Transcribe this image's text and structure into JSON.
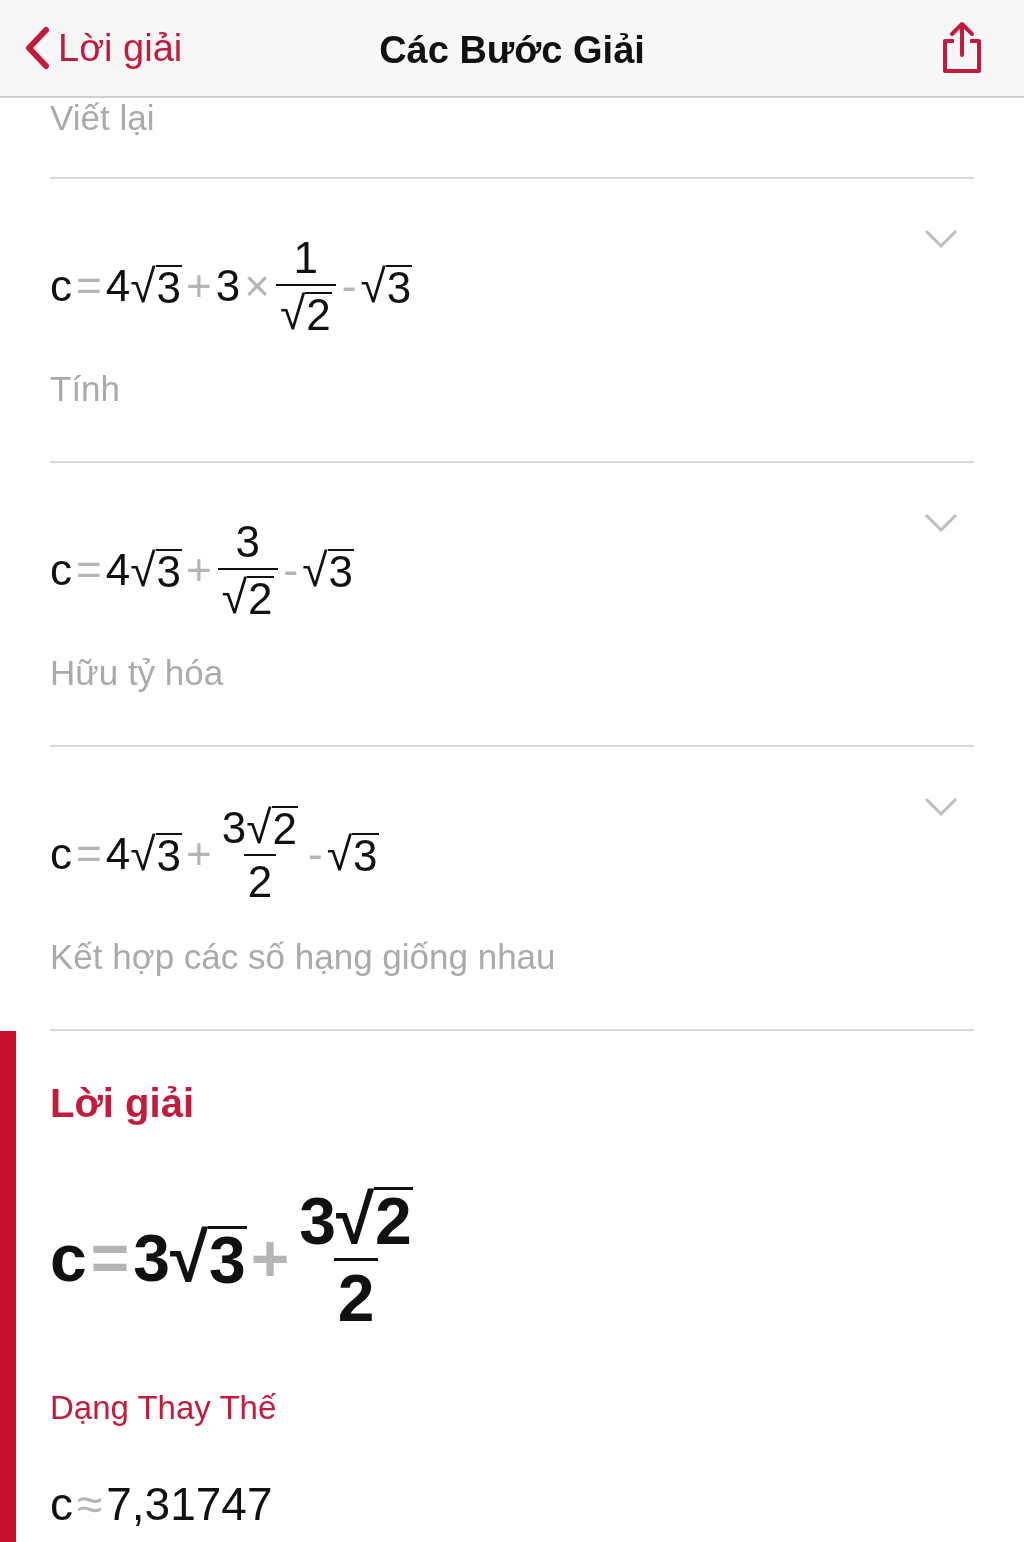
{
  "nav": {
    "back_label": "Lời giải",
    "title": "Các Bước Giải"
  },
  "previous_caption": "Viết lại",
  "steps": [
    {
      "expanded": false,
      "caption": "Tính",
      "formula": [
        {
          "kind": "sym",
          "text": "c"
        },
        {
          "kind": "op",
          "text": "="
        },
        {
          "kind": "sym",
          "text": "4"
        },
        {
          "kind": "sqrt",
          "sign": "√",
          "radicand": "3"
        },
        {
          "kind": "op",
          "text": "+"
        },
        {
          "kind": "sym",
          "text": "3"
        },
        {
          "kind": "op",
          "text": "×"
        },
        {
          "kind": "frac",
          "num": [
            {
              "kind": "sym",
              "text": "1"
            }
          ],
          "den": [
            {
              "kind": "sqrt",
              "sign": "√",
              "radicand": "2"
            }
          ]
        },
        {
          "kind": "op",
          "text": "-"
        },
        {
          "kind": "sqrt",
          "sign": "√",
          "radicand": "3"
        }
      ]
    },
    {
      "expanded": false,
      "caption": "Hữu tỷ hóa",
      "formula": [
        {
          "kind": "sym",
          "text": "c"
        },
        {
          "kind": "op",
          "text": "="
        },
        {
          "kind": "sym",
          "text": "4"
        },
        {
          "kind": "sqrt",
          "sign": "√",
          "radicand": "3"
        },
        {
          "kind": "op",
          "text": "+"
        },
        {
          "kind": "frac",
          "num": [
            {
              "kind": "sym",
              "text": "3"
            }
          ],
          "den": [
            {
              "kind": "sqrt",
              "sign": "√",
              "radicand": "2"
            }
          ]
        },
        {
          "kind": "op",
          "text": "-"
        },
        {
          "kind": "sqrt",
          "sign": "√",
          "radicand": "3"
        }
      ]
    },
    {
      "expanded": false,
      "caption": "Kết hợp các số hạng giống nhau",
      "formula": [
        {
          "kind": "sym",
          "text": "c"
        },
        {
          "kind": "op",
          "text": "="
        },
        {
          "kind": "sym",
          "text": "4"
        },
        {
          "kind": "sqrt",
          "sign": "√",
          "radicand": "3"
        },
        {
          "kind": "op",
          "text": "+"
        },
        {
          "kind": "frac",
          "num": [
            {
              "kind": "sym",
              "text": "3"
            },
            {
              "kind": "sqrt",
              "sign": "√",
              "radicand": "2"
            }
          ],
          "den": [
            {
              "kind": "sym",
              "text": "2"
            }
          ]
        },
        {
          "kind": "op",
          "text": "-"
        },
        {
          "kind": "sqrt",
          "sign": "√",
          "radicand": "3"
        }
      ]
    }
  ],
  "solution": {
    "heading": "Lời giải",
    "formula": [
      {
        "kind": "sym",
        "text": "c"
      },
      {
        "kind": "op",
        "text": "="
      },
      {
        "kind": "sym",
        "text": "3"
      },
      {
        "kind": "sqrt",
        "sign": "√",
        "radicand": "3"
      },
      {
        "kind": "op",
        "text": "+"
      },
      {
        "kind": "frac",
        "num": [
          {
            "kind": "sym",
            "text": "3"
          },
          {
            "kind": "sqrt",
            "sign": "√",
            "radicand": "2"
          }
        ],
        "den": [
          {
            "kind": "sym",
            "text": "2"
          }
        ]
      }
    ],
    "alt_heading": "Dạng Thay Thế",
    "alt_formula": [
      {
        "kind": "sym",
        "text": "c"
      },
      {
        "kind": "op",
        "text": "≈"
      },
      {
        "kind": "sym",
        "text": "7,31747"
      }
    ]
  }
}
